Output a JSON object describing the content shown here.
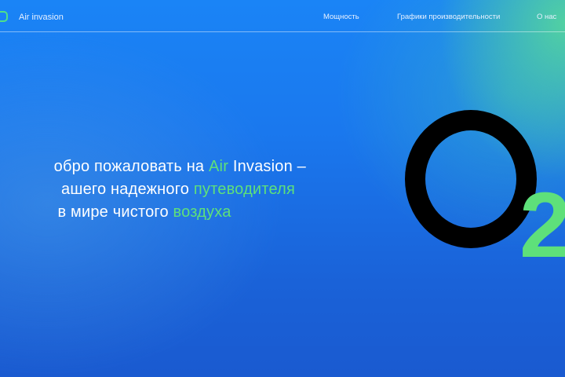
{
  "header": {
    "brand": "Air invasion",
    "nav": [
      "Мощность",
      "Графики производительности",
      "О нас"
    ]
  },
  "hero": {
    "line1_a": "обро пожаловать на ",
    "line1_b": "Air",
    "line1_c": " Invasion –",
    "line2_a": "ашего надежного ",
    "line2_b": "путеводителя",
    "line3_a": "в мире чистого ",
    "line3_b": "воздуха"
  },
  "graphic": {
    "subscript": "2"
  },
  "colors": {
    "accent": "#5ee07a",
    "bg": "#1a78ee"
  }
}
